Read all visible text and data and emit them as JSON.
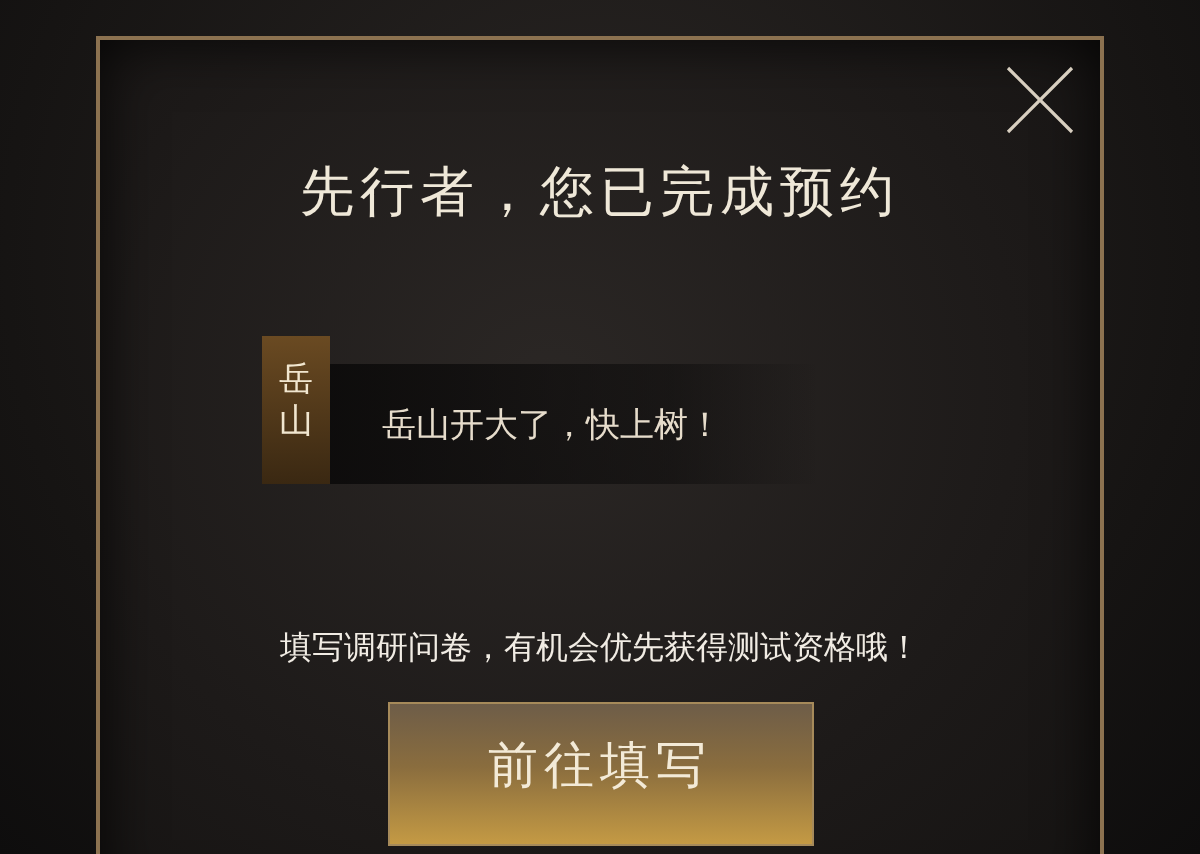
{
  "dialog": {
    "title": "先行者，您已完成预约",
    "message": {
      "speaker": "岳山",
      "text": "岳山开大了，快上树！"
    },
    "prompt": "填写调研问卷，有机会优先获得测试资格哦！",
    "button": "前往填写"
  }
}
